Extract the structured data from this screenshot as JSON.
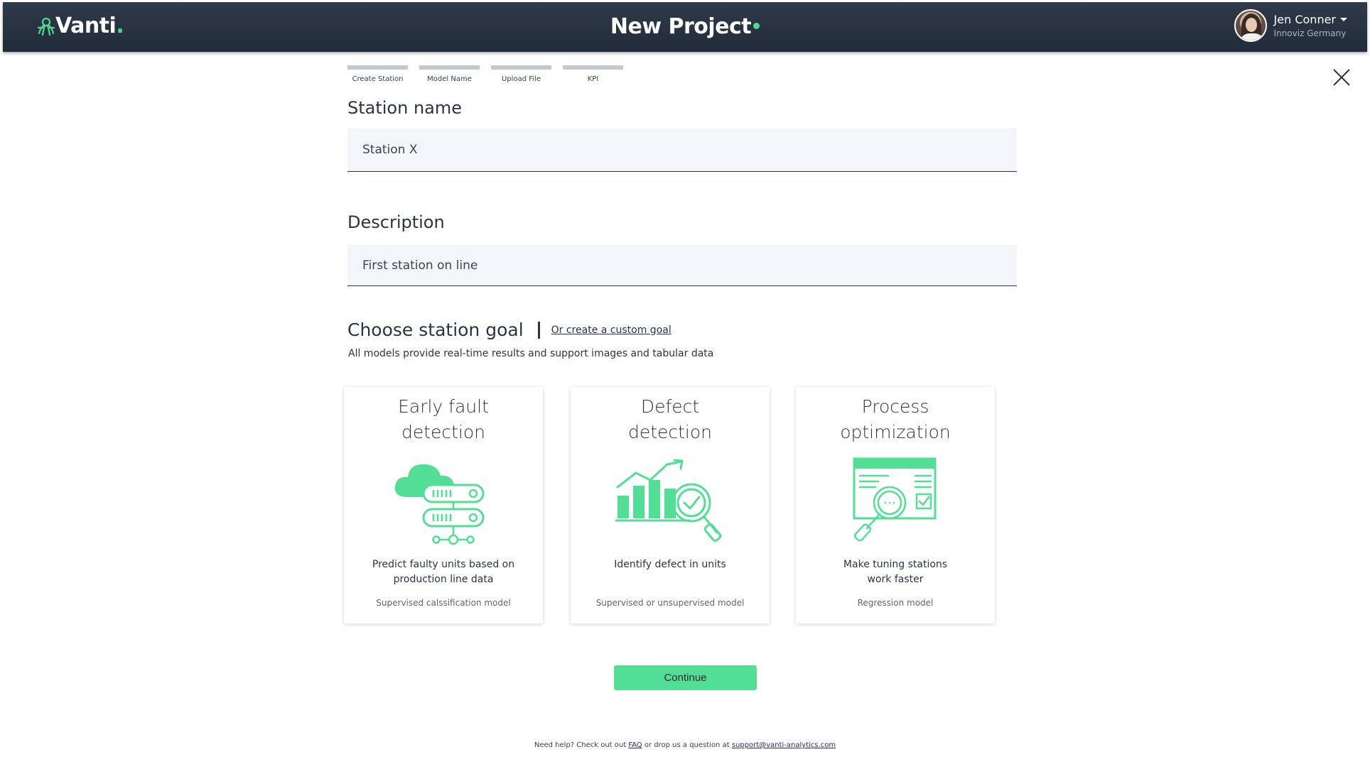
{
  "header": {
    "logo_text": "Vanti",
    "logo_dot": ".",
    "title": "New Project",
    "user_name": "Jen Conner",
    "user_org": "Innoviz Germany"
  },
  "stepper": {
    "steps": [
      "Create Station",
      "Model Name",
      "Upload File",
      "KPI"
    ]
  },
  "form": {
    "station_name_label": "Station name",
    "station_name_value": "Station X",
    "description_label": "Description",
    "description_value": "First station on line"
  },
  "goal": {
    "title": "Choose station goal",
    "custom_link": "Or create a custom goal",
    "subtitle": "All models provide real-time results and support images and tabular data"
  },
  "cards": [
    {
      "title_line1": "Early fault",
      "title_line2": "detection",
      "desc_line1": "Predict faulty units based on",
      "desc_line2": "production line data",
      "model": "Supervised calssification model",
      "icon": "cloud-server-icon"
    },
    {
      "title_line1": "Defect",
      "title_line2": "detection",
      "desc_line1": "Identify defect in units",
      "desc_line2": "",
      "model": "Supervised or  unsupervised model",
      "icon": "chart-magnifier-icon"
    },
    {
      "title_line1": "Process",
      "title_line2": "optimization",
      "desc_line1": "Make tuning stations",
      "desc_line2": "work faster",
      "model": "Regression model",
      "icon": "dashboard-magnifier-icon"
    }
  ],
  "continue_label": "Continue",
  "footer": {
    "prefix": "Need help? Check out out ",
    "faq": "FAQ",
    "middle": " or drop us a question at ",
    "email": "support@vanti-analytics.com"
  },
  "colors": {
    "accent": "#52de94",
    "header_bg": "#2a3442",
    "text": "#2c3444"
  }
}
